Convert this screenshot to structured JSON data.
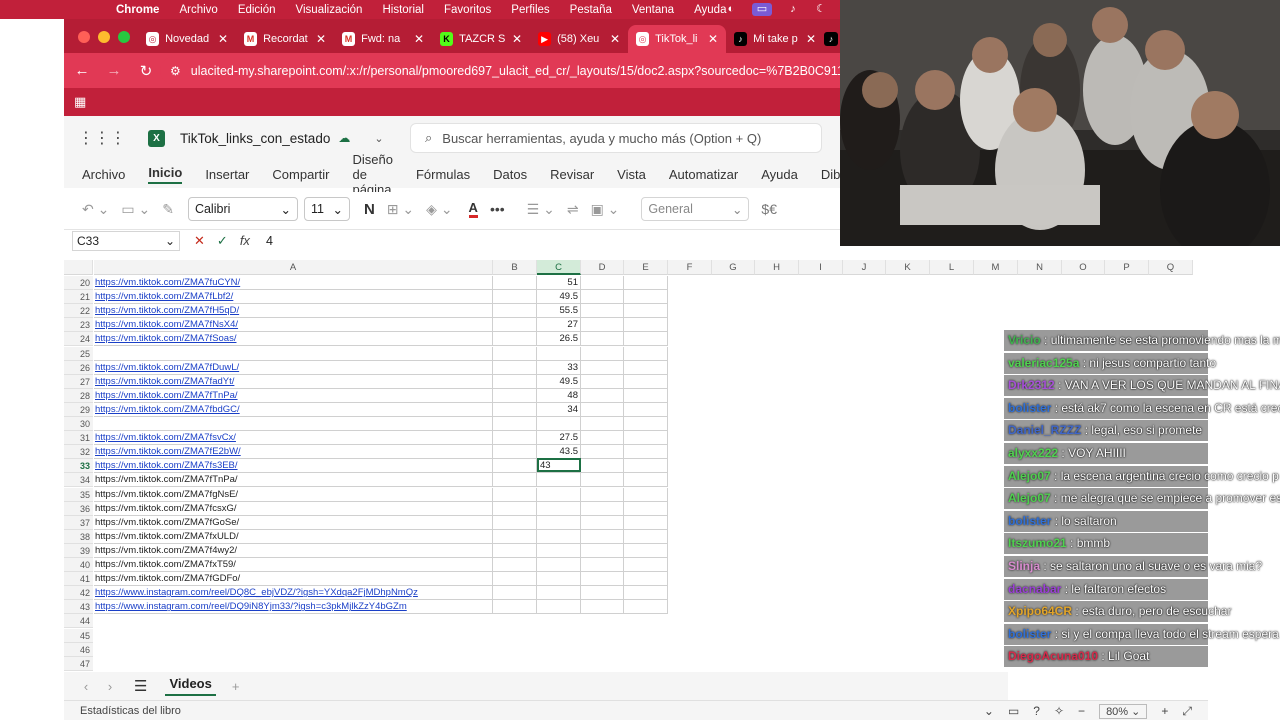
{
  "menubar": {
    "app": "Chrome",
    "items": [
      "Archivo",
      "Edición",
      "Visualización",
      "Historial",
      "Favoritos",
      "Perfiles",
      "Pestaña",
      "Ventana",
      "Ayuda"
    ]
  },
  "tabs": [
    {
      "title": "Novedad",
      "icon": "chrome-icon",
      "active": false
    },
    {
      "title": "Recordat",
      "icon": "gmail-icon",
      "active": false
    },
    {
      "title": "Fwd: na",
      "icon": "gmail-icon",
      "active": false
    },
    {
      "title": "TAZCR S",
      "icon": "kick-icon",
      "active": false
    },
    {
      "title": "(58) Xeu",
      "icon": "youtube-icon",
      "active": false
    },
    {
      "title": "TikTok_li",
      "icon": "chrome-icon",
      "active": true
    },
    {
      "title": "Mi take p",
      "icon": "tiktok-icon",
      "active": false
    }
  ],
  "address": {
    "url": "ulacited-my.sharepoint.com/:x:/r/personal/pmoored697_ulacit_ed_cr/_layouts/15/doc2.aspx?sourcedoc=%7B2B0C9111-461"
  },
  "excel": {
    "filename": "TikTok_links_con_estado",
    "search_placeholder": "Buscar herramientas, ayuda y mucho más (Option + Q)",
    "ribbon_tabs": [
      "Archivo",
      "Inicio",
      "Insertar",
      "Compartir",
      "Diseño de página",
      "Fórmulas",
      "Datos",
      "Revisar",
      "Vista",
      "Automatizar",
      "Ayuda",
      "Dibu"
    ],
    "active_ribbon_tab": "Inicio",
    "font_name": "Calibri",
    "font_size": "11",
    "bold_label": "N",
    "number_format": "General",
    "currency_label": "$€",
    "name_box": "C33",
    "formula_value": "4",
    "fx_label": "fx",
    "columns": [
      "A",
      "B",
      "C",
      "D",
      "E",
      "F",
      "G",
      "H",
      "I",
      "J",
      "K",
      "L",
      "M",
      "N",
      "O",
      "P",
      "Q"
    ],
    "selected_column": "C",
    "active_row": "33",
    "active_cell_value": "43",
    "rows": [
      {
        "n": "20",
        "a": "https://vm.tiktok.com/ZMA7fuCYN/",
        "c": "51",
        "link": true
      },
      {
        "n": "21",
        "a": "https://vm.tiktok.com/ZMA7fLbf2/",
        "c": "49.5",
        "link": true
      },
      {
        "n": "22",
        "a": "https://vm.tiktok.com/ZMA7fH5qD/",
        "c": "55.5",
        "link": true
      },
      {
        "n": "23",
        "a": "https://vm.tiktok.com/ZMA7fNsX4/",
        "c": "27",
        "link": true
      },
      {
        "n": "24",
        "a": "https://vm.tiktok.com/ZMA7fSoas/",
        "c": "26.5",
        "link": true
      },
      {
        "n": "25",
        "a": "",
        "c": "",
        "link": false
      },
      {
        "n": "26",
        "a": "https://vm.tiktok.com/ZMA7fDuwL/",
        "c": "33",
        "link": true
      },
      {
        "n": "27",
        "a": "https://vm.tiktok.com/ZMA7fadYt/",
        "c": "49.5",
        "link": true
      },
      {
        "n": "28",
        "a": "https://vm.tiktok.com/ZMA7fTnPa/",
        "c": "48",
        "link": true
      },
      {
        "n": "29",
        "a": "https://vm.tiktok.com/ZMA7fbdGC/",
        "c": "34",
        "link": true
      },
      {
        "n": "30",
        "a": "",
        "c": "",
        "link": false
      },
      {
        "n": "31",
        "a": "https://vm.tiktok.com/ZMA7fsvCx/",
        "c": "27.5",
        "link": true
      },
      {
        "n": "32",
        "a": "https://vm.tiktok.com/ZMA7fE2bW/",
        "c": "43.5",
        "link": true
      },
      {
        "n": "33",
        "a": "https://vm.tiktok.com/ZMA7fs3EB/",
        "c": "",
        "link": true
      },
      {
        "n": "34",
        "a": "https://vm.tiktok.com/ZMA7fTnPa/",
        "c": "",
        "link": false
      },
      {
        "n": "35",
        "a": "https://vm.tiktok.com/ZMA7fgNsE/",
        "c": "",
        "link": false
      },
      {
        "n": "36",
        "a": "https://vm.tiktok.com/ZMA7fcsxG/",
        "c": "",
        "link": false
      },
      {
        "n": "37",
        "a": "https://vm.tiktok.com/ZMA7fGoSe/",
        "c": "",
        "link": false
      },
      {
        "n": "38",
        "a": "https://vm.tiktok.com/ZMA7fxULD/",
        "c": "",
        "link": false
      },
      {
        "n": "39",
        "a": "https://vm.tiktok.com/ZMA7f4wy2/",
        "c": "",
        "link": false
      },
      {
        "n": "40",
        "a": "https://vm.tiktok.com/ZMA7fxT59/",
        "c": "",
        "link": false
      },
      {
        "n": "41",
        "a": "https://vm.tiktok.com/ZMA7fGDFo/",
        "c": "",
        "link": false
      },
      {
        "n": "42",
        "a": "https://www.instagram.com/reel/DQ8C_ebjVDZ/?igsh=YXdqa2FjMDhpNmQz",
        "c": "",
        "link": true
      },
      {
        "n": "43",
        "a": "https://www.instagram.com/reel/DQ9iN8Yjm33/?igsh=c3pkMjlkZzY4bGZm",
        "c": "",
        "link": true
      },
      {
        "n": "44",
        "a": "",
        "c": "",
        "link": false
      },
      {
        "n": "45",
        "a": "",
        "c": "",
        "link": false
      },
      {
        "n": "46",
        "a": "",
        "c": "",
        "link": false
      },
      {
        "n": "47",
        "a": "",
        "c": "",
        "link": false
      }
    ],
    "sheet_tab": "Videos",
    "status_left": "Estadísticas del libro",
    "zoom": "80%"
  },
  "chat": [
    {
      "user": "Vricio",
      "text": ": ultimamente se esta promoviendo mas la m",
      "color": "#3fb34f"
    },
    {
      "user": "valeriac125a",
      "text": ": ni jesus compartio tanto",
      "color": "#4fd14f"
    },
    {
      "user": "Drk2312",
      "text": ": VAN A VER LOS QUE MANDAN AL FINA",
      "color": "#a64fd8"
    },
    {
      "user": "bolister",
      "text": ": está ak7 como la escena en CR está crec",
      "color": "#2f6fd6"
    },
    {
      "user": "Daniel_RZZZ",
      "text": ": legal, eso si promete",
      "color": "#3f66c8"
    },
    {
      "user": "alyxx222",
      "text": ": VOY AHIIII",
      "color": "#4fd14f"
    },
    {
      "user": "Alejo07",
      "text": ": la escena argentina crecio como crecio p",
      "color": "#4fcf4f"
    },
    {
      "user": "Alejo07",
      "text": ": me alegra que se empiece a promover es",
      "color": "#4fcf4f"
    },
    {
      "user": "bolister",
      "text": ": lo saltaron",
      "color": "#2f6fd6"
    },
    {
      "user": "Itszumo21",
      "text": ": bmmb",
      "color": "#4fd14f"
    },
    {
      "user": "Slinja",
      "text": ": se saltaron uno al suave o es vara mia?",
      "color": "#d88ccf"
    },
    {
      "user": "dacnabar",
      "text": ": le faltaron efectos",
      "color": "#9a3fd6"
    },
    {
      "user": "Xpipo64CR",
      "text": ": esta duro, pero de escuchar",
      "color": "#e2a52a"
    },
    {
      "user": "bolister",
      "text": ": si y el compa lleva todo el stream espera",
      "color": "#2f6fd6"
    },
    {
      "user": "DiegoAcuna010",
      "text": ": Lil Goat",
      "color": "#d62a4a"
    }
  ]
}
